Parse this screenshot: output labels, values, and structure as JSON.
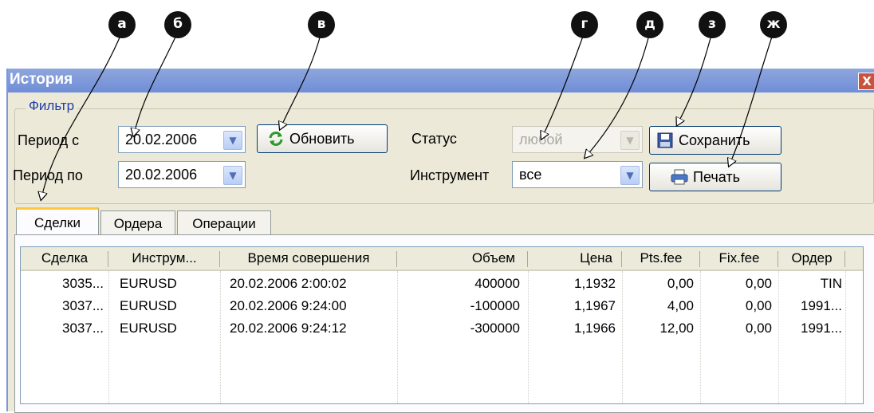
{
  "callouts": [
    "а",
    "б",
    "в",
    "г",
    "д",
    "з",
    "ж"
  ],
  "window": {
    "title": "История",
    "close": "X"
  },
  "filter": {
    "legend": "Фильтр",
    "period_from_label": "Период с",
    "period_from_value": "20.02.2006",
    "period_to_label": "Период по",
    "period_to_value": "20.02.2006",
    "refresh_label": "Обновить",
    "status_label": "Статус",
    "status_value": "любой",
    "instrument_label": "Инструмент",
    "instrument_value": "все",
    "save_label": "Сохранить",
    "print_label": "Печать"
  },
  "tabs": [
    "Сделки",
    "Ордера",
    "Операции"
  ],
  "table": {
    "columns": [
      "Сделка",
      "Инструм...",
      "Время совершения",
      "Объем",
      "Цена",
      "Pts.fee",
      "Fix.fee",
      "Ордер"
    ],
    "rows": [
      [
        "3035...",
        "EURUSD",
        "20.02.2006 2:00:02",
        "400000",
        "1,1932",
        "0,00",
        "0,00",
        "TIN"
      ],
      [
        "3037...",
        "EURUSD",
        "20.02.2006 9:24:00",
        "-100000",
        "1,1967",
        "4,00",
        "0,00",
        "1991..."
      ],
      [
        "3037...",
        "EURUSD",
        "20.02.2006 9:24:12",
        "-300000",
        "1,1966",
        "12,00",
        "0,00",
        "1991..."
      ]
    ]
  },
  "colors": {
    "title_bar": "#6f8ed8",
    "legend_text": "#1f3ea8",
    "active_tab_accent": "#ffc83c"
  }
}
